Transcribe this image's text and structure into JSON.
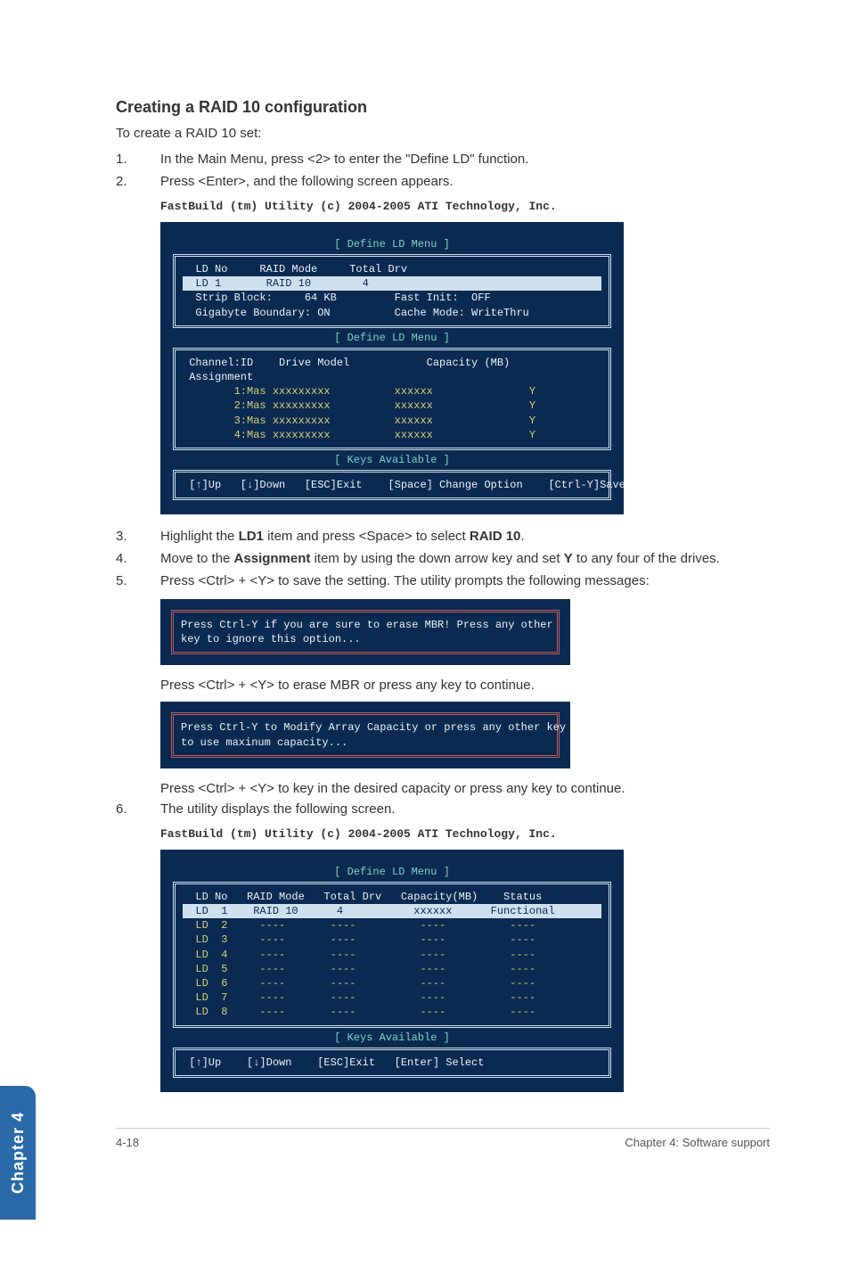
{
  "heading": "Creating a RAID 10 configuration",
  "intro": "To create a RAID 10 set:",
  "steps": {
    "s1": {
      "n": "1.",
      "t": "In the Main Menu, press <2> to enter the \"Define LD\" function."
    },
    "s2": {
      "n": "2.",
      "t": "Press <Enter>, and the following screen appears."
    },
    "s3": {
      "n": "3.",
      "t_pre": "Highlight the ",
      "b1": "LD1",
      "t_mid": " item and press <Space> to select ",
      "b2": "RAID 10",
      "t_post": "."
    },
    "s4": {
      "n": "4.",
      "t_pre": "Move to the ",
      "b1": "Assignment",
      "t_mid": " item by using the down arrow key and set ",
      "b2": "Y",
      "t_post": " to any four of the drives."
    },
    "s5": {
      "n": "5.",
      "t": "Press <Ctrl> + <Y> to save the setting. The utility prompts the following messages:"
    },
    "s6": {
      "n": "6.",
      "t": "The utility displays the following screen."
    }
  },
  "sub1": "Press <Ctrl> + <Y> to erase MBR or press any key to continue.",
  "sub2": "Press <Ctrl> + <Y> to key in the desired capacity or press any key to continue.",
  "term_title": "FastBuild (tm) Utility (c) 2004-2005 ATI Technology, Inc.",
  "define_caption": "[ Define LD Menu ]",
  "keys_caption": "[ Keys Available ]",
  "t1": {
    "header_row": "  LD No     RAID Mode     Total Drv",
    "sel_row": "  LD 1       RAID 10        4",
    "params": "  Strip Block:     64 KB         Fast Init:  OFF\n  Gigabyte Boundary: ON          Cache Mode: WriteThru",
    "col_hdr": " Channel:ID    Drive Model            Capacity (MB)\n Assignment",
    "rows": "        1:Mas xxxxxxxxx          xxxxxx               Y\n        2:Mas xxxxxxxxx          xxxxxx               Y\n        3:Mas xxxxxxxxx          xxxxxx               Y\n        4:Mas xxxxxxxxx          xxxxxx               Y",
    "keys": " [↑]Up   [↓]Down   [ESC]Exit    [Space] Change Option    [Ctrl-Y]Save"
  },
  "msg1": "Press Ctrl-Y if you are sure to erase MBR! Press any other\nkey to ignore this option...",
  "msg2": "Press Ctrl-Y to Modify Array Capacity or press any other key\nto use maxinum capacity...",
  "t2": {
    "hdr": "  LD No   RAID Mode   Total Drv   Capacity(MB)    Status",
    "sel": "  LD  1    RAID 10      4           xxxxxx      Functional",
    "rows": "  LD  2     ----       ----          ----          ----\n  LD  3     ----       ----          ----          ----\n  LD  4     ----       ----          ----          ----\n  LD  5     ----       ----          ----          ----\n  LD  6     ----       ----          ----          ----\n  LD  7     ----       ----          ----          ----\n  LD  8     ----       ----          ----          ----",
    "keys": " [↑]Up    [↓]Down    [ESC]Exit   [Enter] Select"
  },
  "sidetab": "Chapter 4",
  "footer_left": "4-18",
  "footer_right": "Chapter 4: Software support"
}
